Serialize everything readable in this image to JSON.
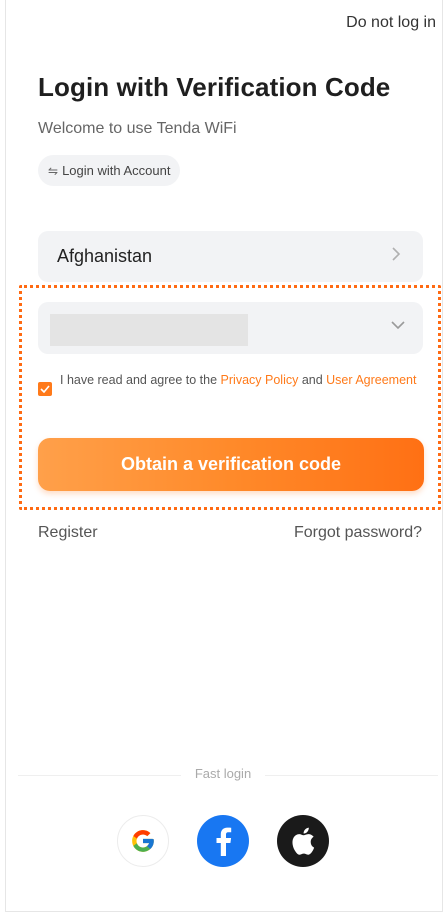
{
  "header": {
    "skip_label": "Do not log in"
  },
  "title": "Login with Verification Code",
  "subtitle": "Welcome to use Tenda WiFi",
  "switch_mode": {
    "icon": "swap-icon",
    "label": "Login with Account"
  },
  "country": {
    "value": "Afghanistan"
  },
  "account_select": {
    "value": ""
  },
  "agreement": {
    "checked": true,
    "prefix": "I have read and agree to the ",
    "privacy_link": "Privacy Policy",
    "and": " and ",
    "user_link": "User Agreement"
  },
  "primary_button": "Obtain a verification code",
  "footer_links": {
    "register": "Register",
    "forgot": "Forgot password?"
  },
  "fast_login": {
    "label": "Fast login",
    "providers": [
      "google",
      "facebook",
      "apple"
    ]
  },
  "colors": {
    "accent": "#ff7a1a",
    "facebook": "#1877f2",
    "apple": "#1a1a1a"
  }
}
